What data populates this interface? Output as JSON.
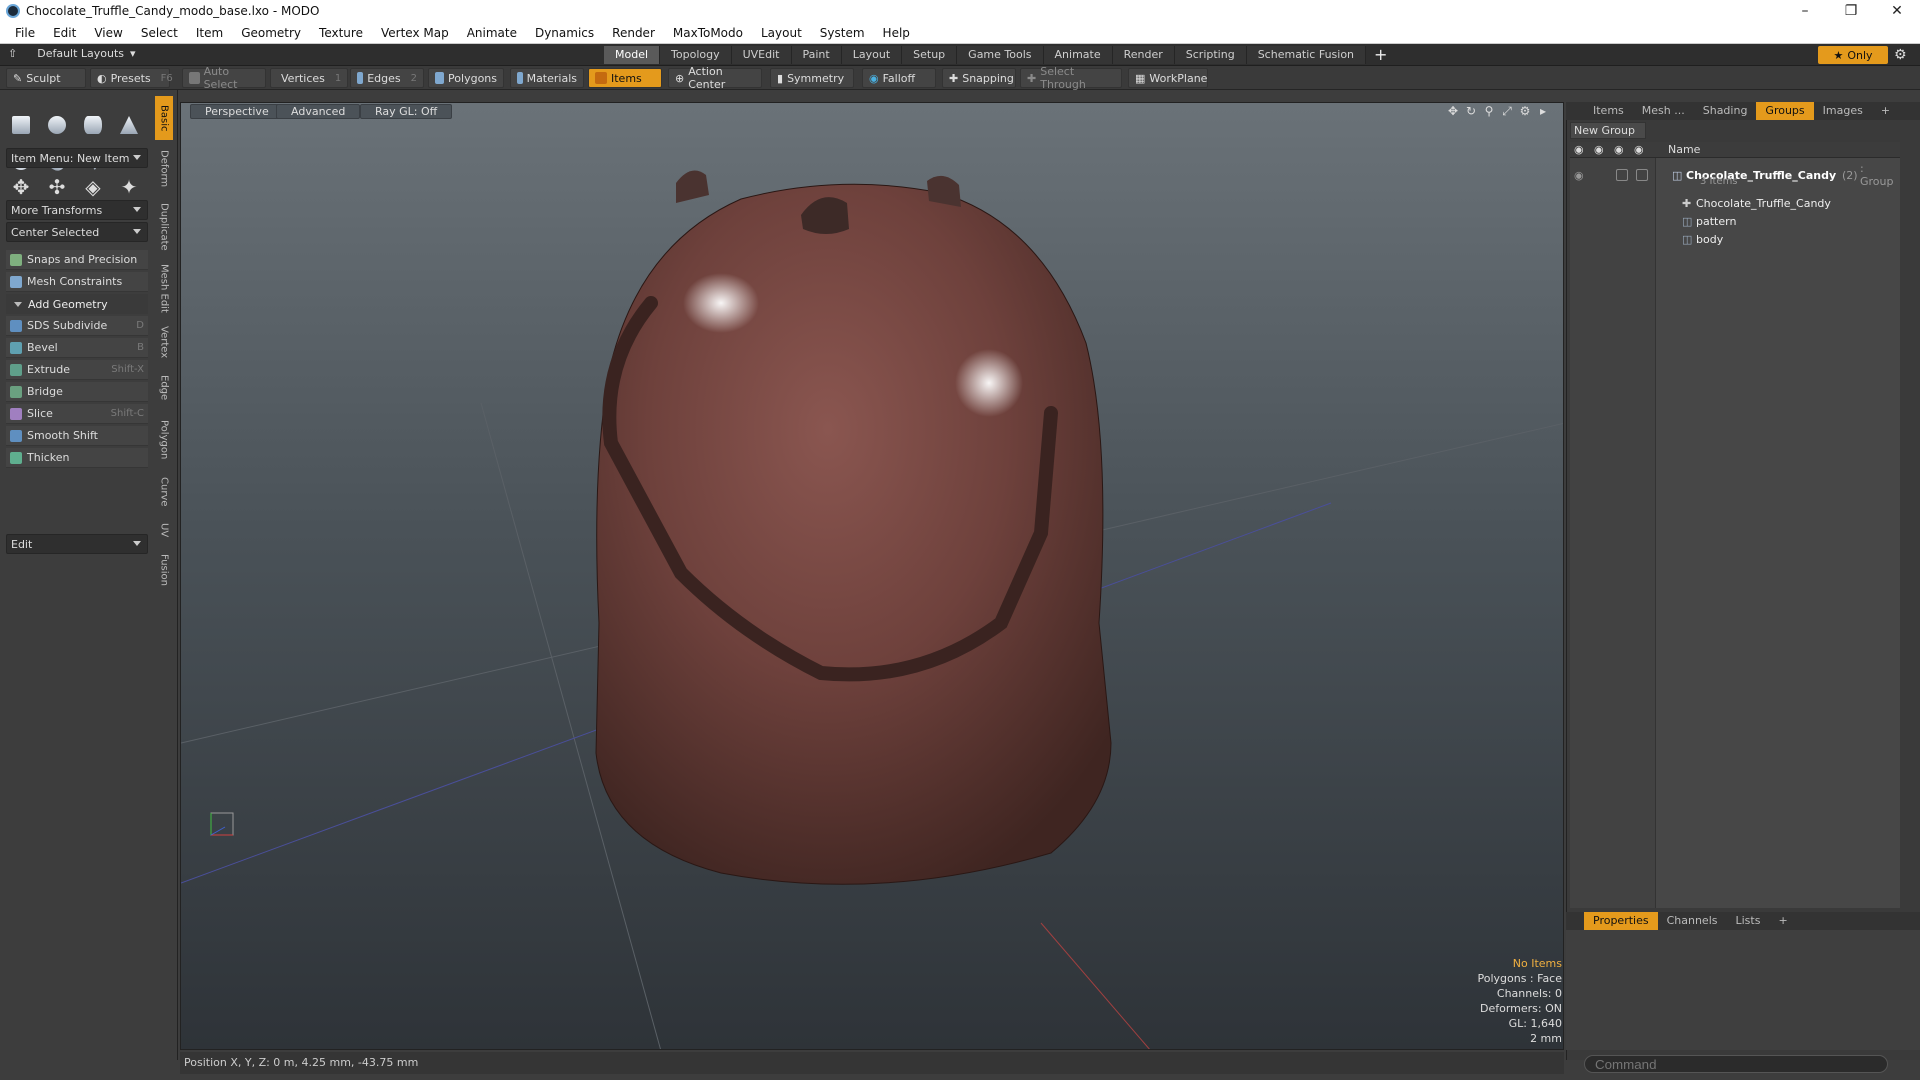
{
  "window": {
    "title": "Chocolate_Truffle_Candy_modo_base.lxo - MODO"
  },
  "menu": [
    "File",
    "Edit",
    "View",
    "Select",
    "Item",
    "Geometry",
    "Texture",
    "Vertex Map",
    "Animate",
    "Dynamics",
    "Render",
    "MaxToModo",
    "Layout",
    "System",
    "Help"
  ],
  "layout": {
    "preset": "Default Layouts",
    "tabs": [
      "Model",
      "Topology",
      "UVEdit",
      "Paint",
      "Layout",
      "Setup",
      "Game Tools",
      "Animate",
      "Render",
      "Scripting",
      "Schematic Fusion"
    ],
    "active_tab": "Model",
    "only_label": "Only"
  },
  "toolbar": {
    "sculpt": "Sculpt",
    "presets": "Presets",
    "presets_key": "F6",
    "auto_select": "Auto Select",
    "vertices": "Vertices",
    "vertices_key": "1",
    "edges": "Edges",
    "edges_key": "2",
    "polygons": "Polygons",
    "materials": "Materials",
    "items": "Items",
    "action_center": "Action Center",
    "symmetry": "Symmetry",
    "falloff": "Falloff",
    "snapping": "Snapping",
    "select_through": "Select Through",
    "workplane": "WorkPlane"
  },
  "left_panel": {
    "item_menu": "Item Menu: New Item",
    "more_transforms": "More Transforms",
    "center_selected": "Center Selected",
    "snaps": "Snaps and Precision",
    "mesh_constraints": "Mesh Constraints",
    "add_geometry": "Add Geometry",
    "tools": [
      {
        "label": "SDS Subdivide",
        "key": "D",
        "color": "#5f8fc0"
      },
      {
        "label": "Bevel",
        "key": "B",
        "color": "#5fa0b0"
      },
      {
        "label": "Extrude",
        "key": "Shift-X",
        "color": "#5f9f8a"
      },
      {
        "label": "Bridge",
        "key": "",
        "color": "#6aa080"
      },
      {
        "label": "Slice",
        "key": "Shift-C",
        "color": "#a07fc0"
      },
      {
        "label": "Smooth Shift",
        "key": "",
        "color": "#5f8fc0"
      },
      {
        "label": "Thicken",
        "key": "",
        "color": "#5faf8f"
      }
    ],
    "edit_dropdown": "Edit",
    "vertical_tabs": [
      "Basic",
      "Deform",
      "Duplicate",
      "Mesh Edit",
      "Vertex",
      "Edge",
      "Polygon",
      "Curve",
      "UV",
      "Fusion"
    ]
  },
  "viewport": {
    "view": "Perspective",
    "shading": "Advanced",
    "raygl": "Ray GL: Off",
    "info": {
      "selection": "No Items",
      "polygons": "Polygons : Face",
      "channels": "Channels: 0",
      "deformers": "Deformers: ON",
      "gl": "GL: 1,640",
      "grid": "2 mm"
    }
  },
  "right_panel": {
    "tabs": [
      "Items",
      "Mesh ...",
      "Shading",
      "Groups",
      "Images"
    ],
    "active_tab": "Groups",
    "new_group": "New Group",
    "name_header": "Name",
    "group": {
      "name": "Chocolate_Truffle_Candy",
      "count": "(2)",
      "type": ": Group",
      "sub": "3 Items"
    },
    "children": [
      "Chocolate_Truffle_Candy",
      "pattern",
      "body"
    ],
    "bottom_tabs": [
      "Properties",
      "Channels",
      "Lists"
    ],
    "bottom_active": "Properties"
  },
  "status": {
    "position": "Position X, Y, Z:  0 m, 4.25 mm, -43.75 mm"
  },
  "command": {
    "placeholder": "Command"
  }
}
